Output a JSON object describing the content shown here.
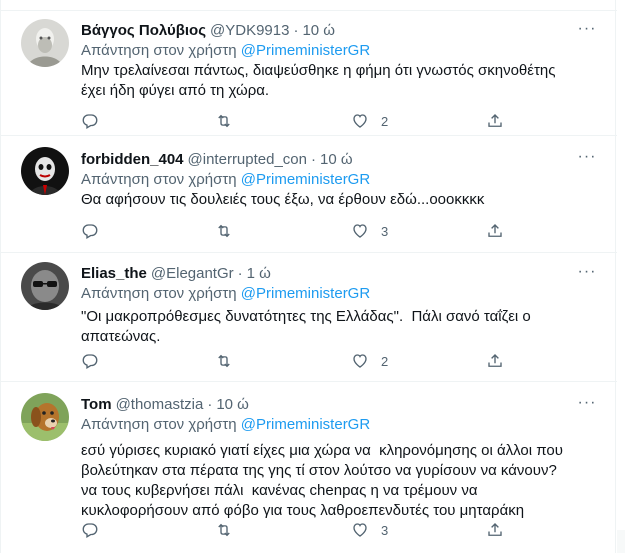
{
  "tweets": [
    {
      "name": "Βάγγος Πολύβιος",
      "handle": "@YDK9913",
      "time": "10 ώ",
      "reply_prefix": "Απάντηση στον χρήστη",
      "reply_to": "@PrimeministerGR",
      "text": "Μην τρελαίνεσαι πάντως, διαψεύσθηκε η φήμη ότι γνωστός σκηνοθέτης\nέχει ήδη φύγει από τη χώρα.",
      "likes": "2"
    },
    {
      "name": "forbidden_404",
      "handle": "@interrupted_con",
      "time": "10 ώ",
      "reply_prefix": "Απάντηση στον χρήστη",
      "reply_to": "@PrimeministerGR",
      "text": "Θα αφήσουν τις δουλειές τους έξω, να έρθουν εδώ...οοοκκκκ",
      "likes": "3"
    },
    {
      "name": "Elias_the",
      "handle": "@ElegantGr",
      "time": "1 ώ",
      "reply_prefix": "Απάντηση στον χρήστη",
      "reply_to": "@PrimeministerGR",
      "text": "\"Οι μακροπρόθεσμες δυνατότητες της Ελλάδας\".  Πάλι σανό ταΐζει ο\nαπατεώνας.",
      "likes": "2"
    },
    {
      "name": "Tom",
      "handle": "@thomastzia",
      "time": "10 ώ",
      "reply_prefix": "Απάντηση στον χρήστη",
      "reply_to": "@PrimeministerGR",
      "text": "εσύ γύρισες κυριακό γιατί είχες μια χώρα να  κληρονόμησης οι άλλοι που\nβολεύτηκαν στα πέρατα της γης τί στον λούτσο να γυρίσουν να κάνουν?\nνα τους κυβερνήσει πάλι  κανένας chenpας η να τρέμουν να\nκυκλοφορήσουν από φόβο για τους λαθροεπενδυτές του μηταράκη",
      "likes": "3"
    }
  ],
  "more_label": "···",
  "icons": {
    "reply": "reply-icon",
    "retweet": "retweet-icon",
    "like": "heart-icon",
    "share": "share-icon",
    "more": "more-icon"
  },
  "colors": {
    "mention": "#1d9bf0",
    "secondary": "#536471",
    "text": "#0f1419",
    "border": "#eff3f4"
  }
}
